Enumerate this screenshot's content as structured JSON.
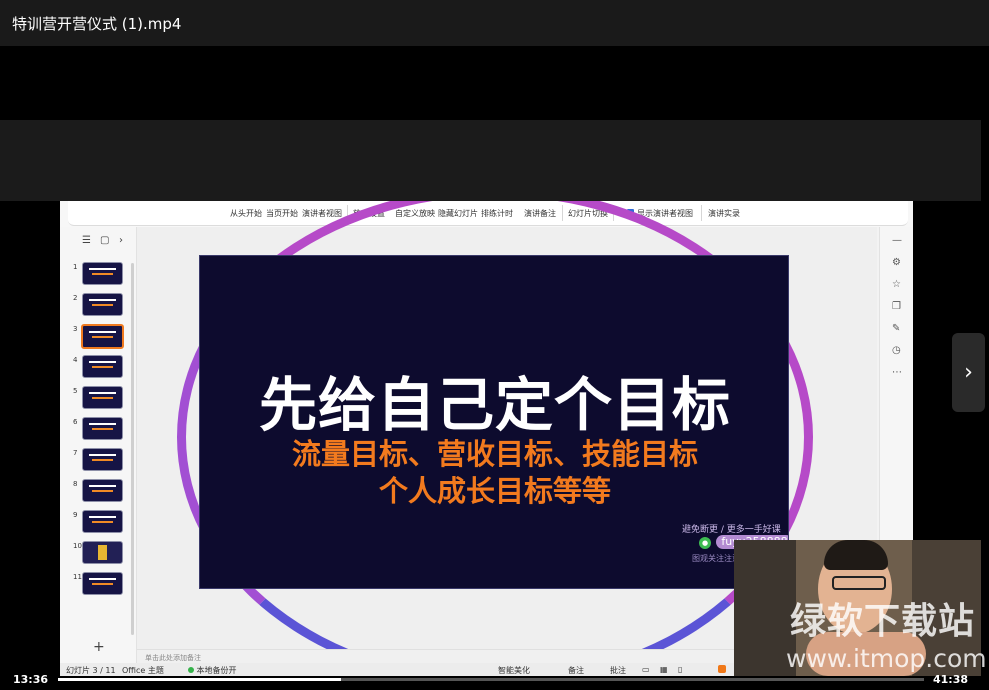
{
  "player": {
    "title": "特训营开营仪式 (1).mp4",
    "time_current": "13:36",
    "time_total": "41:38",
    "progress": 0.327,
    "next_icon": "chevron-right-icon"
  },
  "ribbon": {
    "items": [
      "从头开始",
      "当页开始",
      "演讲者视图",
      "放映设置",
      "自定义放映",
      "隐藏幻灯片",
      "排练计时",
      "演讲备注",
      "幻灯片切换",
      "显示演讲者视图",
      "演讲实录"
    ]
  },
  "thumbs": {
    "numbers": [
      "1",
      "2",
      "3",
      "4",
      "5",
      "6",
      "7",
      "8",
      "9",
      "10",
      "11"
    ],
    "selected": 2
  },
  "slide": {
    "title": "先给自己定个目标",
    "subtitle1": "流量目标、营收目标、技能目标",
    "subtitle2": "个人成长目标等等",
    "watermark_line1": "避免断更 / 更多一手好课",
    "watermark_id": "fuyu258888",
    "watermark_line3": "图观关注注意实际见面"
  },
  "notes": {
    "placeholder": "单击此处添加备注"
  },
  "status": {
    "slide_info": "幻灯片 3 / 11",
    "theme": "Office 主题",
    "backup": "本地备份开",
    "smart": "智能美化",
    "notes": "备注",
    "comments": "批注"
  },
  "overlay": {
    "site_name": "绿软下载站",
    "site_url": "www.itmop.com"
  },
  "colors": {
    "accent_orange": "#f27a1e",
    "slide_bg": "#0d0b2e",
    "ring": "#b64ac8"
  }
}
